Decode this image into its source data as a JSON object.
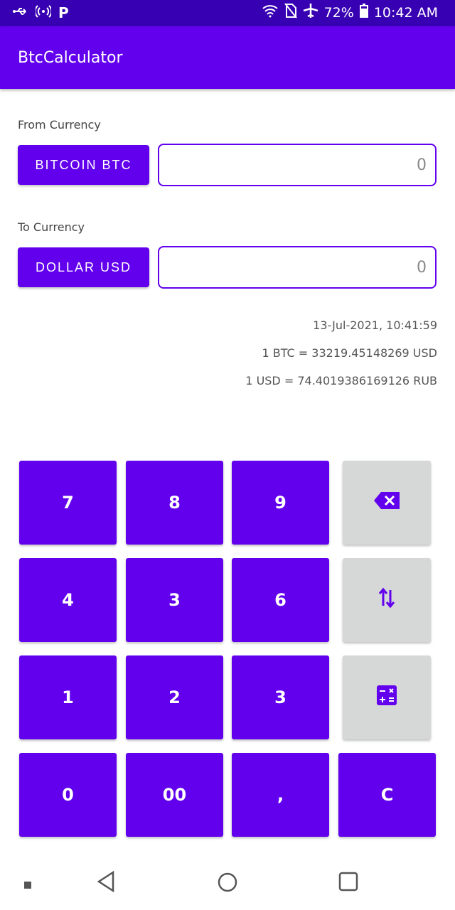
{
  "status_bar": {
    "battery": "72%",
    "time": "10:42 AM",
    "left_icons": [
      "usb-icon",
      "hotspot-icon",
      "parking-icon"
    ],
    "right_icons": [
      "wifi-icon",
      "no-sim-icon",
      "airplane-icon",
      "battery-icon"
    ]
  },
  "app": {
    "title": "BtcCalculator"
  },
  "from": {
    "label": "From Currency",
    "button": "BITCOIN BTC",
    "value": "0"
  },
  "to": {
    "label": "To Currency",
    "button": "DOLLAR USD",
    "value": "0"
  },
  "info": {
    "timestamp": "13-Jul-2021, 10:41:59",
    "rate1": "1 BTC = 33219.45148269 USD",
    "rate2": "1 USD = 74.4019386169126 RUB"
  },
  "keypad": {
    "k7": "7",
    "k8": "8",
    "k9": "9",
    "k4": "4",
    "k5": "3",
    "k6": "6",
    "k1": "1",
    "k2": "2",
    "k3": "3",
    "k0": "0",
    "k00": "00",
    "kcomma": ",",
    "kclear": "C",
    "icons": [
      "backspace-icon",
      "swap-icon",
      "calculator-icon"
    ]
  },
  "colors": {
    "primary": "#6200EE",
    "primary_dark": "#3700B3",
    "gray_key": "#D6D7D7"
  },
  "nav": [
    "nav-menu-icon",
    "back-icon",
    "home-icon",
    "recents-icon"
  ]
}
